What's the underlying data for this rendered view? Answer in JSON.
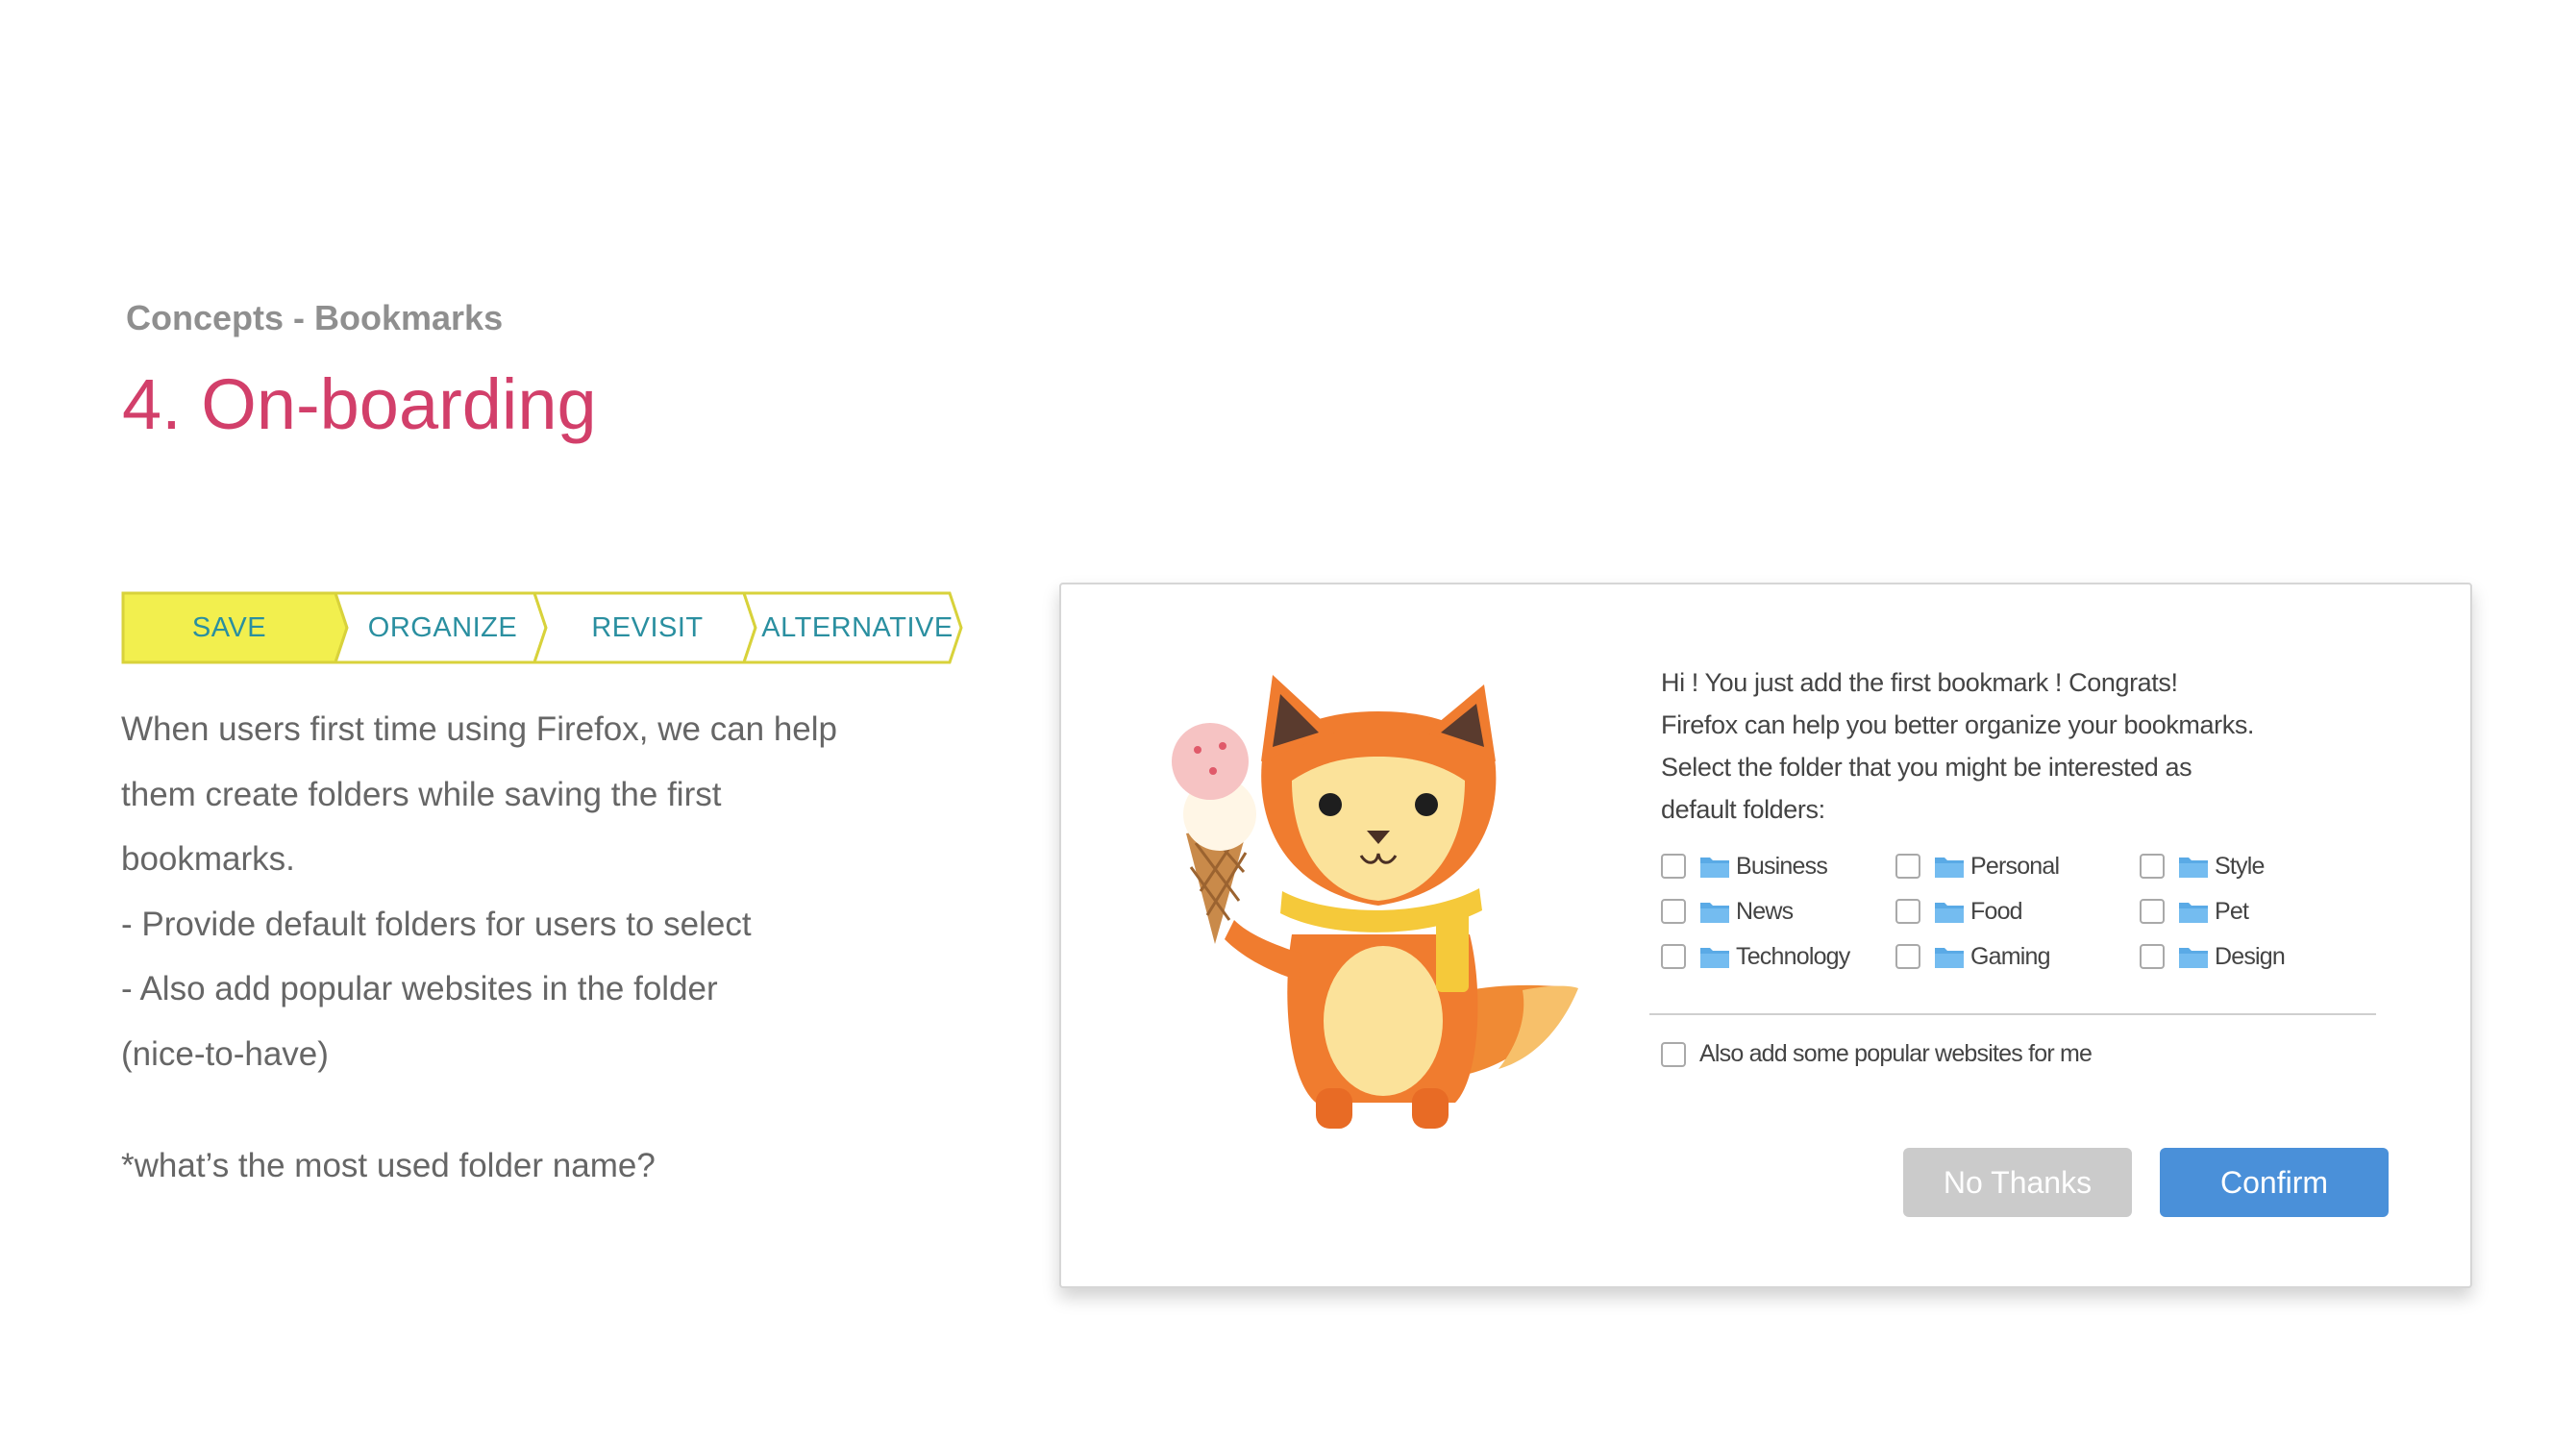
{
  "header": {
    "kicker": "Concepts - Bookmarks",
    "title": "4. On-boarding"
  },
  "steps": [
    {
      "label": "SAVE",
      "active": true
    },
    {
      "label": "ORGANIZE",
      "active": false
    },
    {
      "label": "REVISIT",
      "active": false
    },
    {
      "label": "ALTERNATIVE",
      "active": false
    }
  ],
  "description": {
    "lines": [
      "When users first time using Firefox, we can help",
      "them create folders while saving the first",
      "bookmarks.",
      "- Provide default folders for users to select",
      "- Also add popular websites in the folder",
      "(nice-to-have)"
    ],
    "note": "*what’s the most used folder name?"
  },
  "dialog": {
    "message_lines": [
      "Hi ! You just add the first bookmark ! Congrats!",
      "Firefox can help you better organize your bookmarks.",
      "Select the folder that you might be interested as",
      "default folders:"
    ],
    "folders": [
      {
        "label": "Business",
        "checked": false
      },
      {
        "label": "Personal",
        "checked": false
      },
      {
        "label": "Style",
        "checked": false
      },
      {
        "label": "News",
        "checked": false
      },
      {
        "label": "Food",
        "checked": false
      },
      {
        "label": "Pet",
        "checked": false
      },
      {
        "label": "Technology",
        "checked": false
      },
      {
        "label": "Gaming",
        "checked": false
      },
      {
        "label": "Design",
        "checked": false
      }
    ],
    "popular_label": "Also add some popular websites for me",
    "no_thanks_label": "No Thanks",
    "confirm_label": "Confirm"
  },
  "colors": {
    "title": "#d23f6a",
    "step_active_fill": "#f2ef4e",
    "step_border": "#d8d23b",
    "step_text": "#2a8fa0",
    "folder_icon": "#5aaae6",
    "confirm": "#4a90d9",
    "no_thanks": "#cbcbcb"
  },
  "icons": {
    "folder": "folder-icon",
    "mascot": "fox-mascot-with-ice-cream"
  }
}
